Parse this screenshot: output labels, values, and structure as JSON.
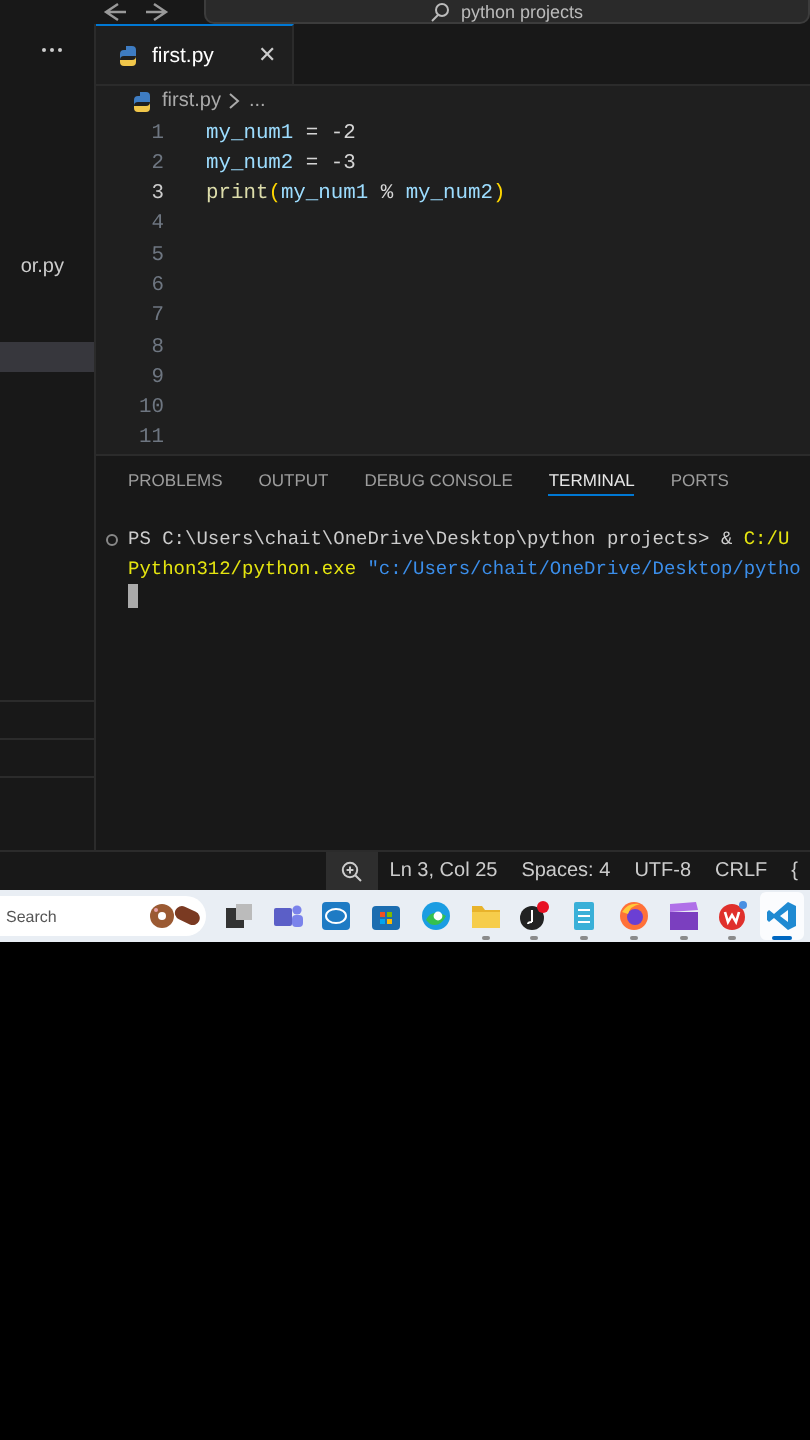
{
  "title_bar": {
    "search": "python projects"
  },
  "sidebar": {
    "items": [
      {
        "label": "or.py",
        "selected": false
      },
      {
        "selected": true
      }
    ]
  },
  "editor": {
    "tabs": [
      {
        "label": "first.py",
        "selected": true,
        "close": "✕"
      }
    ],
    "breadcrumb": {
      "file": "first.py",
      "rest": "..."
    },
    "lines": [
      {
        "number": "1",
        "current": false,
        "tokens": [
          {
            "text": "my_num1",
            "kind": "variable"
          },
          {
            "text": " = ",
            "kind": "operator"
          },
          {
            "text": "-2",
            "kind": "number"
          }
        ]
      },
      {
        "number": "2",
        "current": false,
        "tokens": [
          {
            "text": "my_num2",
            "kind": "variable"
          },
          {
            "text": " = ",
            "kind": "operator"
          },
          {
            "text": "-3",
            "kind": "number"
          }
        ]
      },
      {
        "number": "3",
        "current": true,
        "tokens": [
          {
            "text": "print",
            "kind": "function"
          },
          {
            "text": "(",
            "kind": "bracket"
          },
          {
            "text": "my_num1",
            "kind": "variable"
          },
          {
            "text": " % ",
            "kind": "operator"
          },
          {
            "text": "my_num2",
            "kind": "variable"
          },
          {
            "text": ")",
            "kind": "bracket"
          }
        ]
      },
      {
        "number": "4",
        "current": false
      },
      {
        "number": "5",
        "current": false
      },
      {
        "number": "6",
        "current": false
      },
      {
        "number": "7",
        "current": false
      },
      {
        "number": "8",
        "current": false
      },
      {
        "number": "9",
        "current": false
      },
      {
        "number": "10",
        "current": false
      },
      {
        "number": "11",
        "current": false
      }
    ]
  },
  "panel": {
    "tabs": [
      {
        "label": "PROBLEMS",
        "selected": false
      },
      {
        "label": "OUTPUT",
        "selected": false
      },
      {
        "label": "DEBUG CONSOLE",
        "selected": false
      },
      {
        "label": "TERMINAL",
        "selected": true
      },
      {
        "label": "PORTS",
        "selected": false
      }
    ],
    "terminal": [
      [
        {
          "text": "PS C:\\Users\\chait\\OneDrive\\Desktop\\python projects> & ",
          "kind": "plain"
        },
        {
          "text": "C:/U",
          "kind": "command"
        }
      ],
      [
        {
          "text": "Python312/python.exe",
          "kind": "command"
        },
        {
          "text": "\"c:/Users/chait/OneDrive/Desktop/pytho",
          "kind": "string"
        }
      ]
    ]
  },
  "status_bar": {
    "items": [
      "Ln 3, Col 25",
      "Spaces: 4",
      "UTF-8",
      "CRLF",
      "{"
    ]
  },
  "taskbar": {
    "search": "Search",
    "apps": [
      {
        "kind": "taskview",
        "running": false,
        "selected": false
      },
      {
        "kind": "teams",
        "running": false,
        "selected": false
      },
      {
        "kind": "dell",
        "running": false,
        "selected": false
      },
      {
        "kind": "store",
        "running": false,
        "selected": false
      },
      {
        "kind": "edge",
        "running": false,
        "selected": false
      },
      {
        "kind": "folder",
        "running": true,
        "selected": false
      },
      {
        "kind": "music",
        "running": true,
        "selected": false
      },
      {
        "kind": "notepad",
        "running": true,
        "selected": false
      },
      {
        "kind": "firefox",
        "running": true,
        "selected": false
      },
      {
        "kind": "clapper",
        "running": true,
        "selected": false
      },
      {
        "kind": "wps",
        "running": true,
        "selected": false
      },
      {
        "kind": "vscode",
        "running": true,
        "selected": true
      }
    ]
  }
}
